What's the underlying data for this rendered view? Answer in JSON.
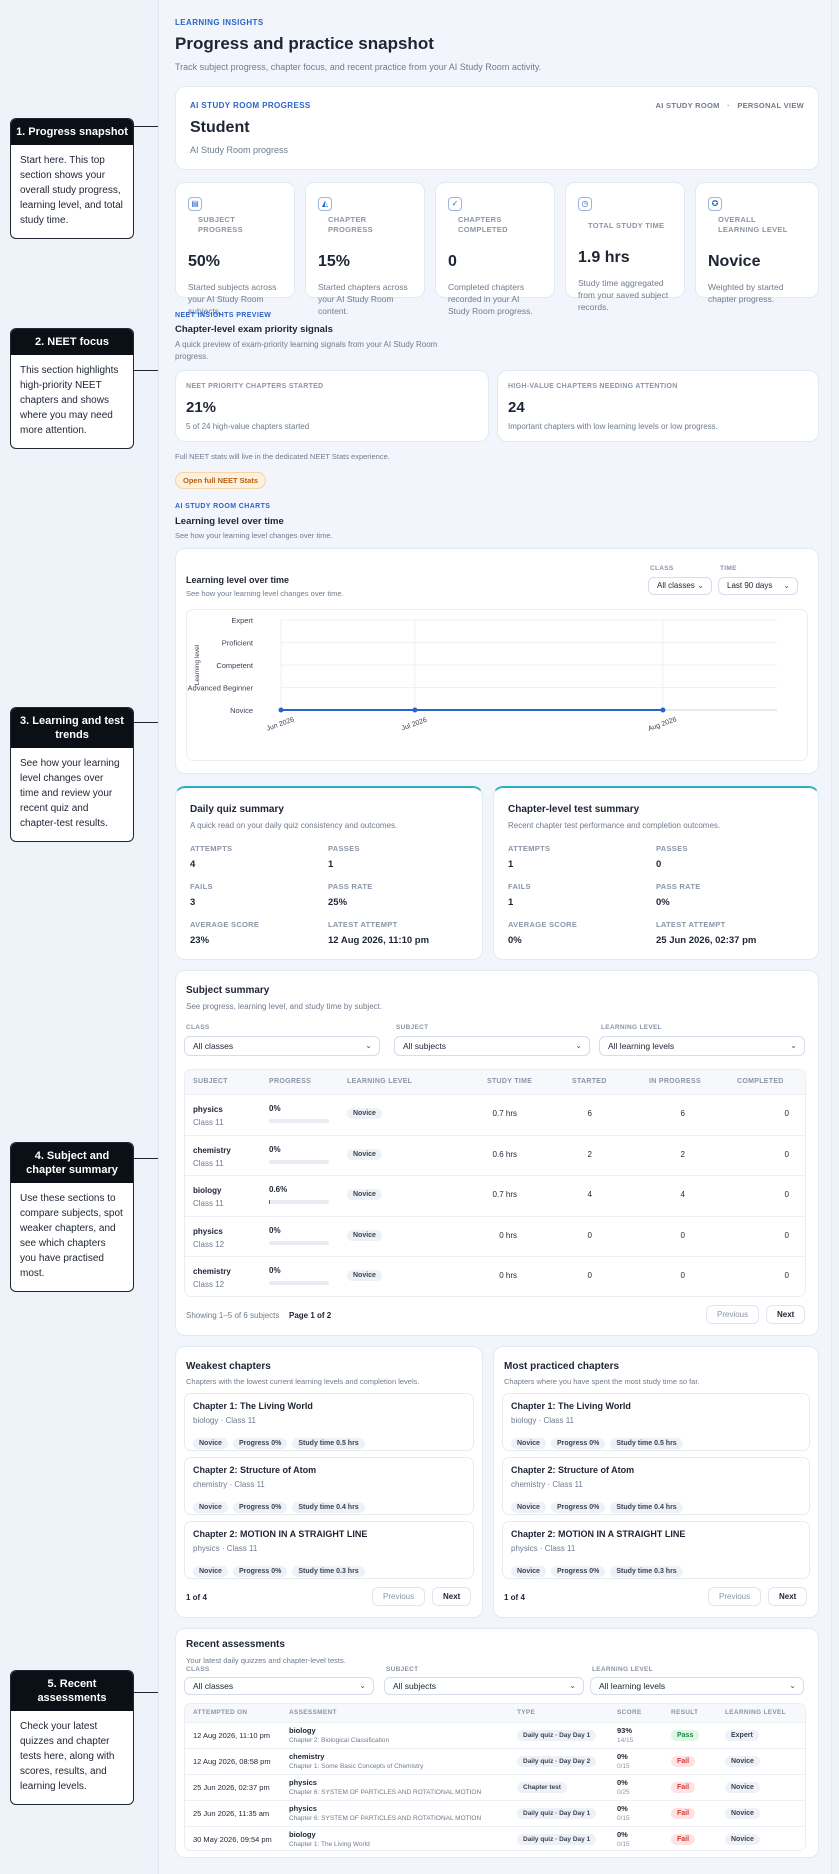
{
  "header": {
    "eyebrow": "LEARNING INSIGHTS",
    "title": "Progress and practice snapshot",
    "subtitle": "Track subject progress, chapter focus, and recent practice from your AI Study Room activity."
  },
  "profile": {
    "eyebrow": "AI STUDY ROOM PROGRESS",
    "name": "Student",
    "sub": "AI Study Room progress",
    "meta_left": "AI STUDY ROOM",
    "meta_sep": "·",
    "meta_right": "PERSONAL VIEW"
  },
  "stats": [
    {
      "icon": "book-icon",
      "label": "SUBJECT PROGRESS",
      "value": "50%",
      "desc": "Started subjects across your AI Study Room subjects."
    },
    {
      "icon": "layers-icon",
      "label": "CHAPTER PROGRESS",
      "value": "15%",
      "desc": "Started chapters across your AI Study Room content."
    },
    {
      "icon": "check-circle-icon",
      "label": "CHAPTERS COMPLETED",
      "value": "0",
      "desc": "Completed chapters recorded in your AI Study Room progress."
    },
    {
      "icon": "clock-icon",
      "label": "TOTAL STUDY TIME",
      "value": "1.9 hrs",
      "desc": "Study time aggregated from your saved subject records."
    },
    {
      "icon": "award-icon",
      "label": "OVERALL LEARNING LEVEL",
      "value": "Novice",
      "desc": "Weighted by started chapter progress."
    }
  ],
  "neet": {
    "eyebrow": "NEET INSIGHTS PREVIEW",
    "title": "Chapter-level exam priority signals",
    "desc": "A quick preview of exam-priority learning signals from your AI Study Room progress.",
    "cards": [
      {
        "label": "NEET PRIORITY CHAPTERS STARTED",
        "value": "21%",
        "desc": "5 of 24 high-value chapters started"
      },
      {
        "label": "HIGH-VALUE CHAPTERS NEEDING ATTENTION",
        "value": "24",
        "desc": "Important chapters with low learning levels or low progress."
      }
    ],
    "note": "Full NEET stats will live in the dedicated NEET Stats experience.",
    "button": "Open full NEET Stats"
  },
  "charts_section": {
    "eyebrow": "AI STUDY ROOM CHARTS",
    "title": "Learning level over time",
    "desc": "See how your learning level changes over time."
  },
  "chart_card": {
    "title": "Learning level over time",
    "desc": "See how your learning level changes over time.",
    "class_label": "CLASS",
    "class_value": "All classes",
    "time_label": "TIME",
    "time_value": "Last 90 days"
  },
  "chart_data": {
    "type": "line",
    "title": "Learning level over time",
    "ylabel": "Learning level",
    "xlabel": "",
    "y_categories": [
      "Novice",
      "Advanced Beginner",
      "Competent",
      "Proficient",
      "Expert"
    ],
    "x_ticks": [
      "Jun 2026",
      "Jul 2026",
      "Aug 2026"
    ],
    "points": [
      {
        "x": "Jun 2026",
        "y": "Novice"
      },
      {
        "x": "Jul 2026",
        "y": "Novice"
      },
      {
        "x": "Aug 2026",
        "y": "Novice"
      }
    ],
    "color": "#2a64c9",
    "grid": true
  },
  "quiz": {
    "title": "Daily quiz summary",
    "desc": "A quick read on your daily quiz consistency and outcomes.",
    "items": [
      {
        "k": "ATTEMPTS",
        "v": "4"
      },
      {
        "k": "PASSES",
        "v": "1"
      },
      {
        "k": "FAILS",
        "v": "3"
      },
      {
        "k": "PASS RATE",
        "v": "25%"
      },
      {
        "k": "AVERAGE SCORE",
        "v": "23%"
      },
      {
        "k": "LATEST ATTEMPT",
        "v": "12 Aug 2026, 11:10 pm"
      }
    ]
  },
  "test": {
    "title": "Chapter-level test summary",
    "desc": "Recent chapter test performance and completion outcomes.",
    "items": [
      {
        "k": "ATTEMPTS",
        "v": "1"
      },
      {
        "k": "PASSES",
        "v": "0"
      },
      {
        "k": "FAILS",
        "v": "1"
      },
      {
        "k": "PASS RATE",
        "v": "0%"
      },
      {
        "k": "AVERAGE SCORE",
        "v": "0%"
      },
      {
        "k": "LATEST ATTEMPT",
        "v": "25 Jun 2026, 02:37 pm"
      }
    ]
  },
  "subject_summary": {
    "title": "Subject summary",
    "desc": "See progress, learning level, and study time by subject.",
    "filters": [
      {
        "label": "CLASS",
        "value": "All classes"
      },
      {
        "label": "SUBJECT",
        "value": "All subjects"
      },
      {
        "label": "LEARNING LEVEL",
        "value": "All learning levels"
      }
    ],
    "columns": [
      "SUBJECT",
      "PROGRESS",
      "LEARNING LEVEL",
      "STUDY TIME",
      "STARTED",
      "IN PROGRESS",
      "COMPLETED"
    ],
    "rows": [
      {
        "subject": "physics",
        "class": "Class 11",
        "progress": "0%",
        "progress_value": 0,
        "level": "Novice",
        "time": "0.7 hrs",
        "started": "6",
        "in_progress": "6",
        "completed": "0"
      },
      {
        "subject": "chemistry",
        "class": "Class 11",
        "progress": "0%",
        "progress_value": 0,
        "level": "Novice",
        "time": "0.6 hrs",
        "started": "2",
        "in_progress": "2",
        "completed": "0"
      },
      {
        "subject": "biology",
        "class": "Class 11",
        "progress": "0.6%",
        "progress_value": 0.6,
        "level": "Novice",
        "time": "0.7 hrs",
        "started": "4",
        "in_progress": "4",
        "completed": "0"
      },
      {
        "subject": "physics",
        "class": "Class 12",
        "progress": "0%",
        "progress_value": 0,
        "level": "Novice",
        "time": "0 hrs",
        "started": "0",
        "in_progress": "0",
        "completed": "0"
      },
      {
        "subject": "chemistry",
        "class": "Class 12",
        "progress": "0%",
        "progress_value": 0,
        "level": "Novice",
        "time": "0 hrs",
        "started": "0",
        "in_progress": "0",
        "completed": "0"
      }
    ],
    "footer_left": "Showing 1–5 of 6 subjects",
    "footer_page": "Page 1 of 2",
    "prev": "Previous",
    "next": "Next"
  },
  "weakest": {
    "title": "Weakest chapters",
    "desc": "Chapters with the lowest current learning levels and completion levels.",
    "items": [
      {
        "title": "Chapter 1: The Living World",
        "sub": "biology · Class 11",
        "level": "Novice",
        "progress": "Progress 0%",
        "time": "Study time 0.5 hrs"
      },
      {
        "title": "Chapter 2: Structure of Atom",
        "sub": "chemistry · Class 11",
        "level": "Novice",
        "progress": "Progress 0%",
        "time": "Study time 0.4 hrs"
      },
      {
        "title": "Chapter 2: MOTION IN A STRAIGHT LINE",
        "sub": "physics · Class 11",
        "level": "Novice",
        "progress": "Progress 0%",
        "time": "Study time 0.3 hrs"
      }
    ],
    "page": "1 of 4",
    "prev": "Previous",
    "next": "Next"
  },
  "most_practiced": {
    "title": "Most practiced chapters",
    "desc": "Chapters where you have spent the most study time so far.",
    "items": [
      {
        "title": "Chapter 1: The Living World",
        "sub": "biology · Class 11",
        "level": "Novice",
        "progress": "Progress 0%",
        "time": "Study time 0.5 hrs"
      },
      {
        "title": "Chapter 2: Structure of Atom",
        "sub": "chemistry · Class 11",
        "level": "Novice",
        "progress": "Progress 0%",
        "time": "Study time 0.4 hrs"
      },
      {
        "title": "Chapter 2: MOTION IN A STRAIGHT LINE",
        "sub": "physics · Class 11",
        "level": "Novice",
        "progress": "Progress 0%",
        "time": "Study time 0.3 hrs"
      }
    ],
    "page": "1 of 4",
    "prev": "Previous",
    "next": "Next"
  },
  "recent": {
    "title": "Recent assessments",
    "desc": "Your latest daily quizzes and chapter-level tests.",
    "filters": [
      {
        "label": "CLASS",
        "value": "All classes"
      },
      {
        "label": "SUBJECT",
        "value": "All subjects"
      },
      {
        "label": "LEARNING LEVEL",
        "value": "All learning levels"
      }
    ],
    "columns": [
      "ATTEMPTED ON",
      "ASSESSMENT",
      "TYPE",
      "SCORE",
      "RESULT",
      "LEARNING LEVEL"
    ],
    "rows": [
      {
        "date": "12 Aug 2026, 11:10 pm",
        "subject": "biology",
        "chapter": "Chapter 2: Biological Classification",
        "type": "Daily quiz · Day Day 1",
        "score": "93%",
        "score_sub": "14/15",
        "result": "Pass",
        "level": "Expert"
      },
      {
        "date": "12 Aug 2026, 08:58 pm",
        "subject": "chemistry",
        "chapter": "Chapter 1: Some Basic Concepts of Chemistry",
        "type": "Daily quiz · Day Day 2",
        "score": "0%",
        "score_sub": "0/15",
        "result": "Fail",
        "level": "Novice"
      },
      {
        "date": "25 Jun 2026, 02:37 pm",
        "subject": "physics",
        "chapter": "Chapter 6: SYSTEM OF PARTICLES AND ROTATIONAL MOTION",
        "type": "Chapter test",
        "score": "0%",
        "score_sub": "0/25",
        "result": "Fail",
        "level": "Novice"
      },
      {
        "date": "25 Jun 2026, 11:35 am",
        "subject": "physics",
        "chapter": "Chapter 6: SYSTEM OF PARTICLES AND ROTATIONAL MOTION",
        "type": "Daily quiz · Day Day 1",
        "score": "0%",
        "score_sub": "0/15",
        "result": "Fail",
        "level": "Novice"
      },
      {
        "date": "30 May 2026, 09:54 pm",
        "subject": "biology",
        "chapter": "Chapter 1: The Living World",
        "type": "Daily quiz · Day Day 1",
        "score": "0%",
        "score_sub": "0/15",
        "result": "Fail",
        "level": "Novice"
      }
    ]
  },
  "annotations": [
    {
      "title": "1. Progress snapshot",
      "body": "Start here. This top section shows your overall study progress, learning level, and total study time."
    },
    {
      "title": "2. NEET focus",
      "body": "This section highlights high-priority NEET chapters and shows where you may need more attention."
    },
    {
      "title": "3. Learning and test trends",
      "body": "See how your learning level changes over time and review your recent quiz and chapter-test results."
    },
    {
      "title": "4. Subject and chapter summary",
      "body": "Use these sections to compare subjects, spot weaker chapters, and see which chapters you have practised most."
    },
    {
      "title": "5. Recent assessments",
      "body": "Check your latest quizzes and chapter tests here, along with scores, results, and learning levels."
    }
  ]
}
